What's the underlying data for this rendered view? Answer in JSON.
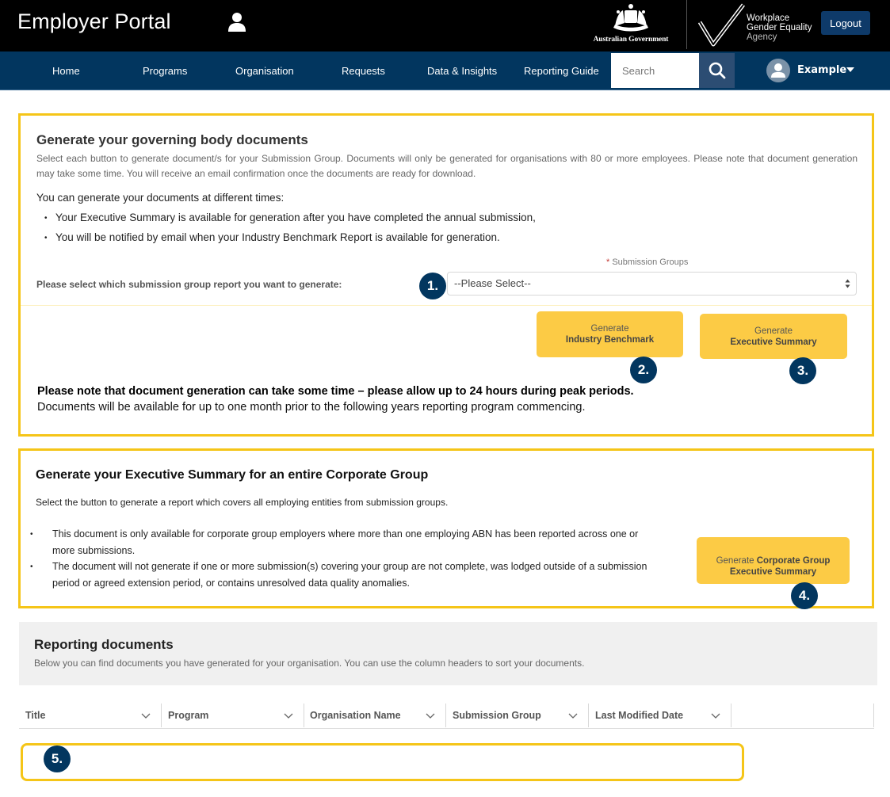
{
  "header": {
    "portal_title": "Employer Portal",
    "user_icon": "person-icon",
    "gov_logo_text": "Australian Government",
    "agency_logo": {
      "line1": "Workplace",
      "line2": "Gender Equality",
      "line3": "Agency"
    },
    "logout_label": "Logout"
  },
  "nav": {
    "items": [
      {
        "label": "Home"
      },
      {
        "label": "Programs"
      },
      {
        "label": "Organisation"
      },
      {
        "label": "Requests"
      },
      {
        "label": "Data & Insights"
      },
      {
        "label": "Reporting Guide"
      }
    ],
    "search_placeholder": "Search",
    "search_icon": "magnifier-icon",
    "user_name": "Example"
  },
  "governing": {
    "title": "Generate your governing body documents",
    "description": "Select each button to generate document/s for your Submission Group. Documents will only be generated for organisations with 80 or more employees. Please note that document generation may take some time. You will receive an email confirmation once the documents are ready for download.",
    "times_intro": "You can generate your documents at different times:",
    "bullets": [
      "Your Executive Summary is available for generation after you have completed the annual submission,",
      "You will be notified by email when your Industry Benchmark Report is available for generation."
    ],
    "submission_groups_label": "Submission Groups",
    "required_marker": "*",
    "select_prompt": "Please select which submission group report you want to generate:",
    "select_value": "--Please Select--",
    "btn_benchmark": {
      "line1": "Generate",
      "line2": "Industry Benchmark"
    },
    "btn_exec": {
      "line1": "Generate",
      "line2": "Executive Summary"
    },
    "note_bold": "Please note that document generation can take some time – please allow up to 24 hours during peak periods.",
    "note_plain": "Documents will be available for up to one month prior to the following years reporting program commencing."
  },
  "corporate": {
    "title": "Generate your Executive Summary for an entire Corporate Group",
    "description": "Select the button to generate a report which covers all employing entities from submission groups.",
    "bullets": [
      "This document is only available for corporate group employers where more than one employing ABN has been reported across one or more submissions.",
      "The document will not generate if one or more submission(s) covering your group are not complete, was lodged outside of a submission period or agreed extension period, or contains unresolved data quality anomalies."
    ],
    "btn": {
      "prefix": "Generate ",
      "bold1": "Corporate Group",
      "bold2": "Executive Summary"
    }
  },
  "reporting": {
    "title": "Reporting documents",
    "description": "Below you can find documents you have generated for your organisation. You can use the column headers to sort your documents.",
    "columns": [
      {
        "label": "Title"
      },
      {
        "label": "Program"
      },
      {
        "label": "Organisation Name"
      },
      {
        "label": "Submission Group"
      },
      {
        "label": "Last Modified Date"
      }
    ]
  },
  "badges": [
    "1.",
    "2.",
    "3.",
    "4.",
    "5."
  ],
  "colors": {
    "header_bg": "#000000",
    "nav_bg": "#02365f",
    "accent_yellow": "#f5c518",
    "button_yellow": "#fccb45",
    "badge_navy": "#02365f"
  }
}
